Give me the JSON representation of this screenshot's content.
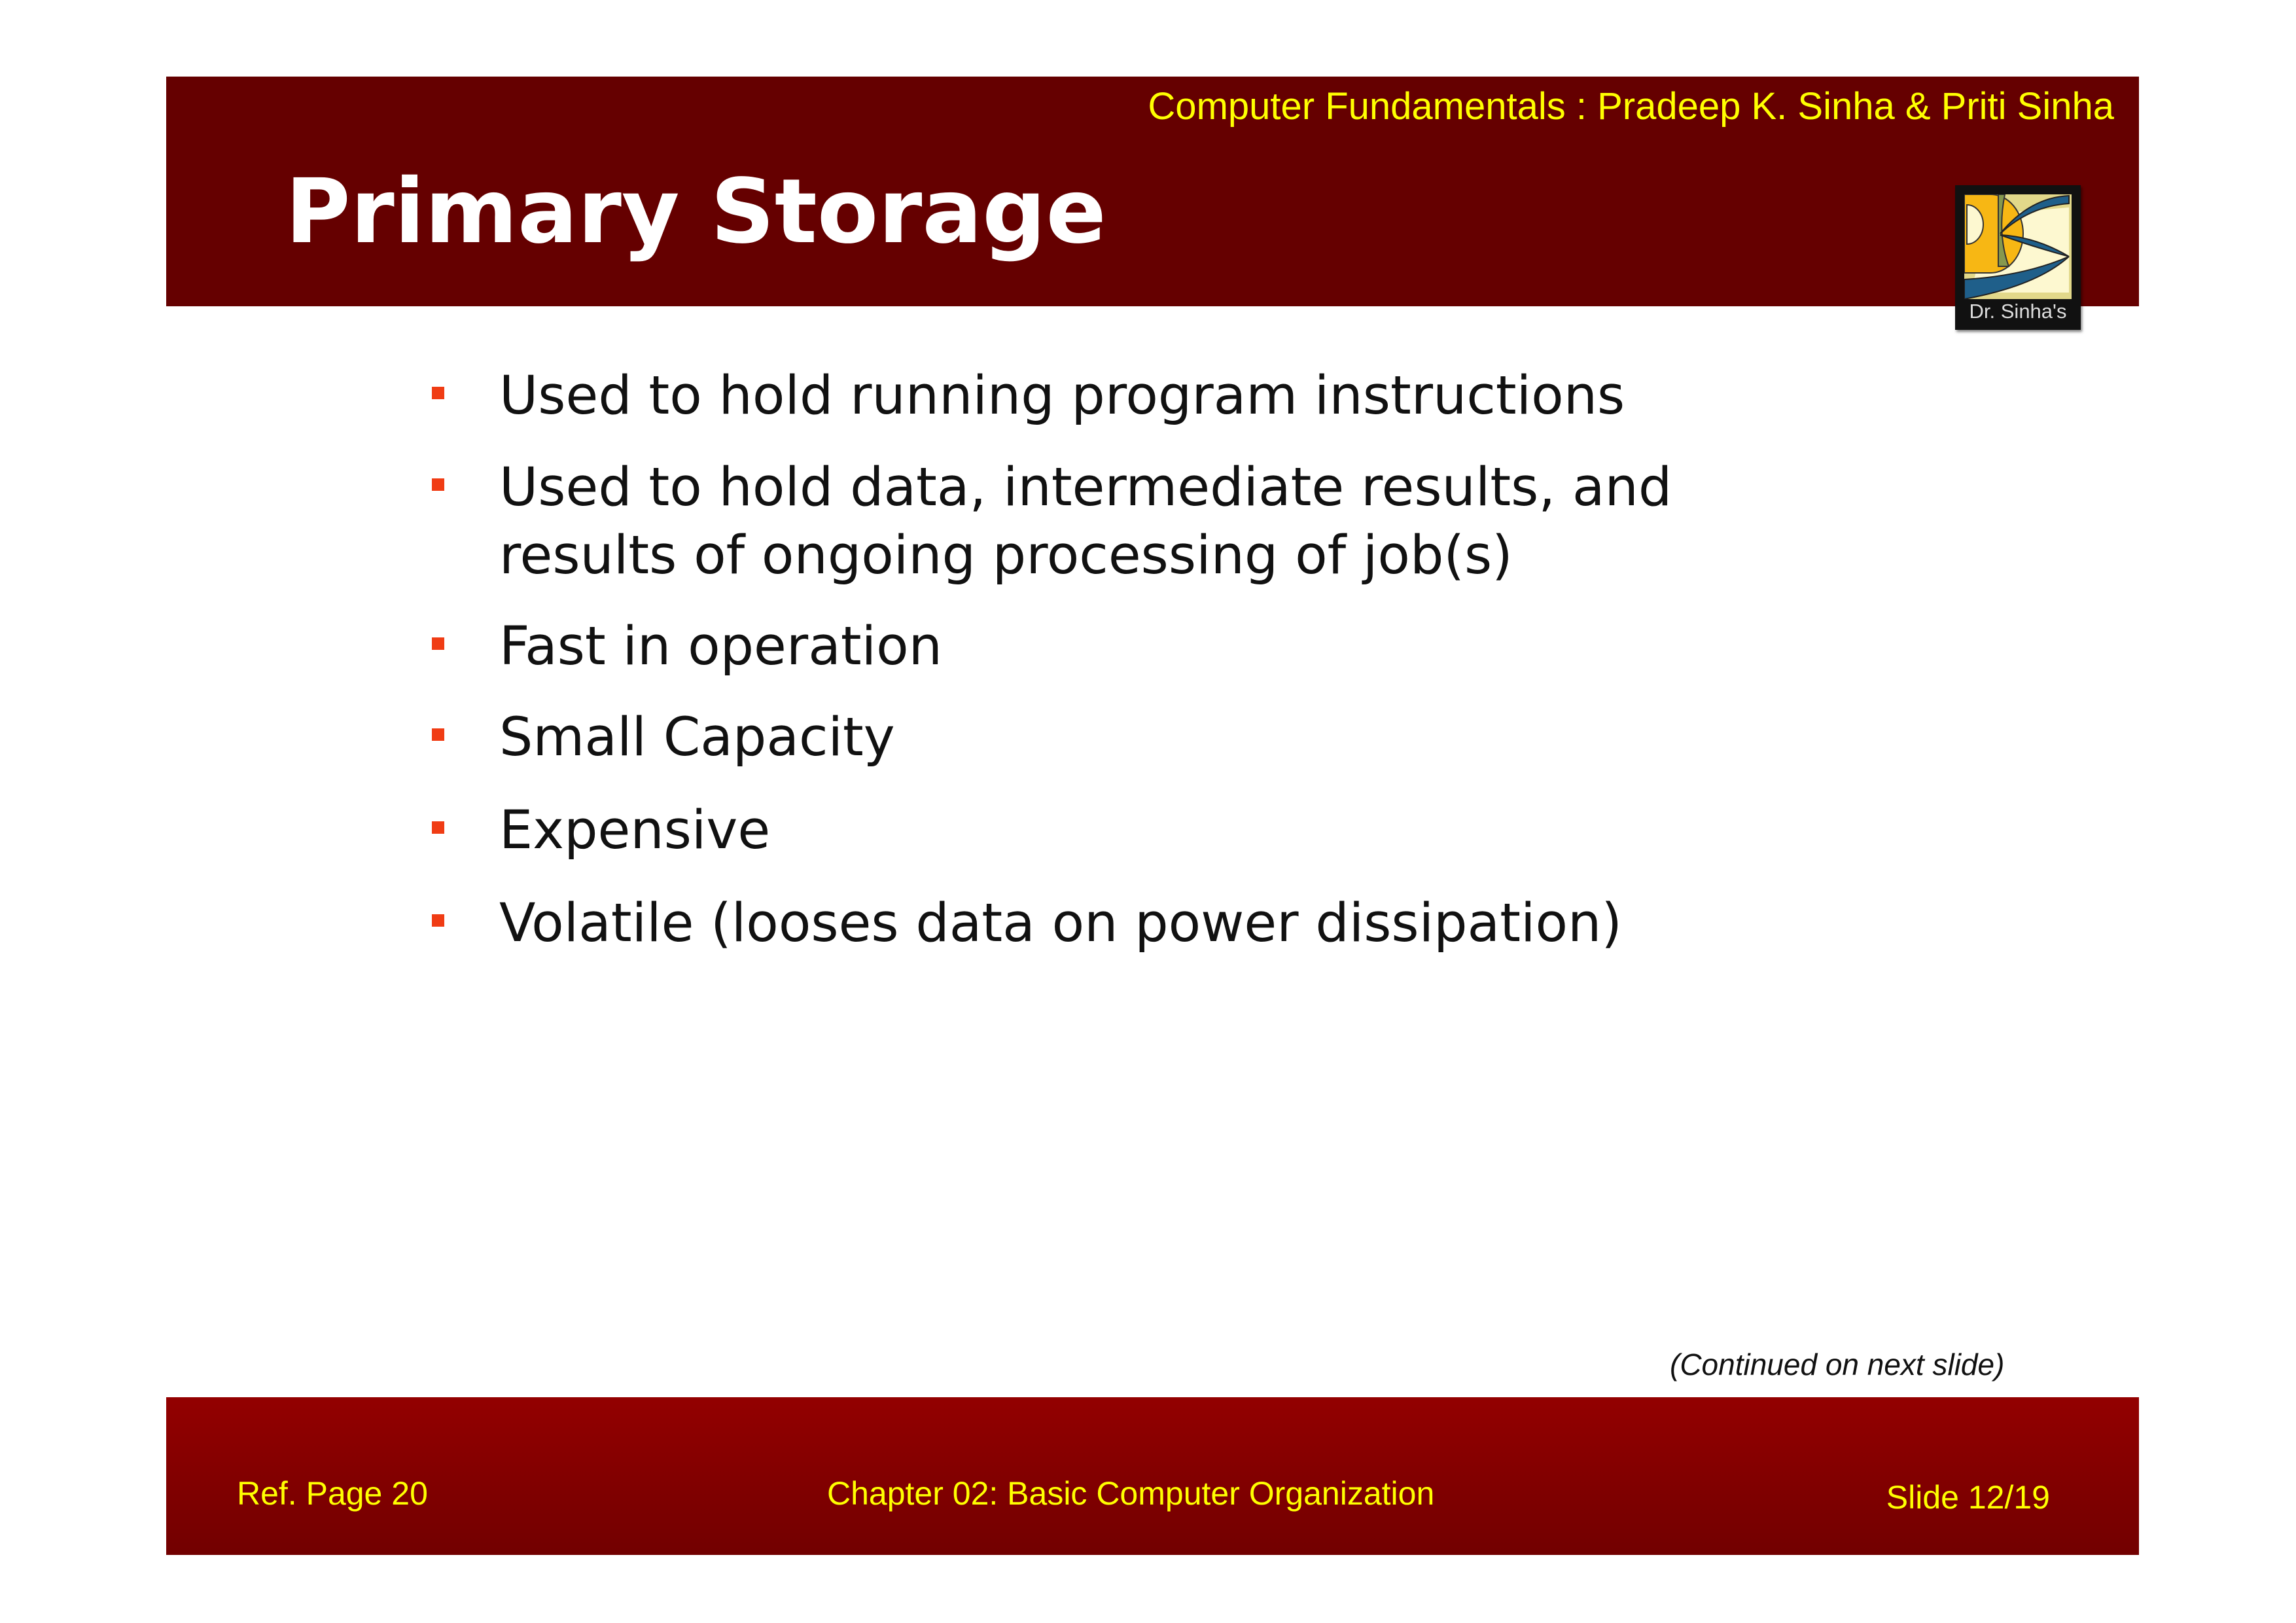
{
  "header": {
    "book": "Computer Fundamentals : Pradeep K. Sinha & Priti Sinha",
    "title": "Primary Storage",
    "logo_text": "Dr. Sinha's"
  },
  "bullets": [
    "Used to hold running program instructions",
    "Used to hold data, intermediate results, and results of ongoing processing of job(s)",
    "Fast in operation",
    "Small Capacity",
    "Expensive",
    "Volatile (looses data on power dissipation)"
  ],
  "bullet_lines": {
    "b1_line1": "Used to hold data, intermediate results, and",
    "b1_line2": "results of ongoing processing of job(s)"
  },
  "continued": "(Continued on next slide)",
  "footer": {
    "ref": "Ref. Page  20",
    "chapter": "Chapter 02: Basic Computer Organization",
    "slide": "Slide 12/19"
  },
  "colors": {
    "header": "#650000",
    "accent_text": "#ffff00",
    "bullet": "#f03c14"
  }
}
